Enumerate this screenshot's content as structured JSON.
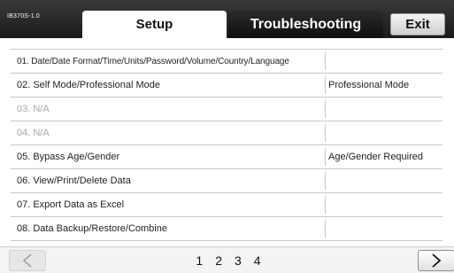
{
  "header": {
    "model": "IB370S-1.0",
    "tabs": [
      {
        "label": "Setup",
        "active": true
      },
      {
        "label": "Troubleshooting",
        "active": false
      }
    ],
    "exit_label": "Exit"
  },
  "rows": [
    {
      "label": "01. Date/Date Format/Time/Units/Password/Volume/Country/Language",
      "value": "",
      "enabled": true
    },
    {
      "label": "02. Self Mode/Professional Mode",
      "value": "Professional Mode",
      "enabled": true
    },
    {
      "label": "03. N/A",
      "value": "",
      "enabled": false
    },
    {
      "label": "04. N/A",
      "value": "",
      "enabled": false
    },
    {
      "label": "05. Bypass Age/Gender",
      "value": "Age/Gender Required",
      "enabled": true
    },
    {
      "label": "06. View/Print/Delete Data",
      "value": "",
      "enabled": true
    },
    {
      "label": "07. Export Data as Excel",
      "value": "",
      "enabled": true
    },
    {
      "label": "08. Data Backup/Restore/Combine",
      "value": "",
      "enabled": true
    }
  ],
  "pagination": {
    "pages": [
      "1",
      "2",
      "3",
      "4"
    ],
    "current_page": "1",
    "prev_enabled": false,
    "next_enabled": true
  },
  "icons": {
    "prev": "chevron-left-icon",
    "next": "chevron-right-icon"
  },
  "colors": {
    "header_bg": "#1f1f1f",
    "active_tab_bg": "#ffffff",
    "disabled_text": "#a8a8a8",
    "row_border": "#c9c9c9"
  }
}
